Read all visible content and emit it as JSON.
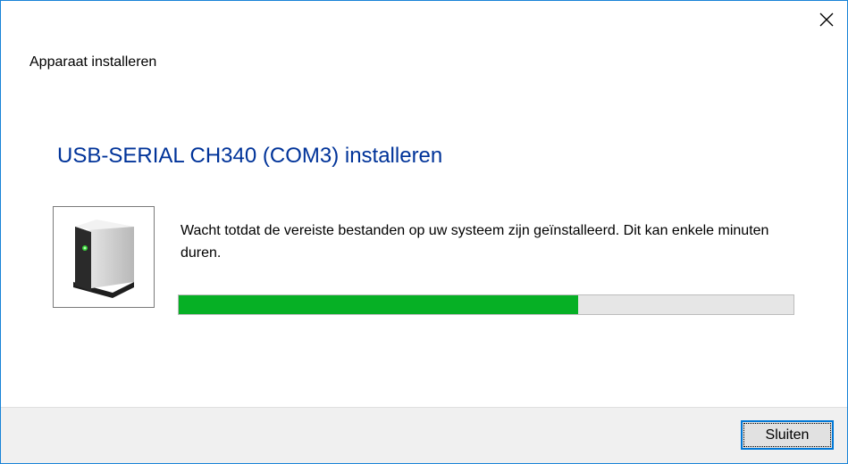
{
  "window": {
    "title": "Apparaat installeren",
    "close_icon": "close-icon"
  },
  "main": {
    "heading": "USB-SERIAL CH340 (COM3) installeren",
    "device_icon": "drive-device-icon",
    "message": "Wacht totdat de vereiste bestanden op uw systeem zijn geïnstalleerd. Dit kan enkele minuten duren.",
    "progress_fraction": 0.65
  },
  "footer": {
    "close_button_label": "Sluiten"
  },
  "colors": {
    "heading": "#003399",
    "progress_fill": "#06b025",
    "window_border": "#1883d7",
    "button_focus_border": "#0078d7"
  }
}
